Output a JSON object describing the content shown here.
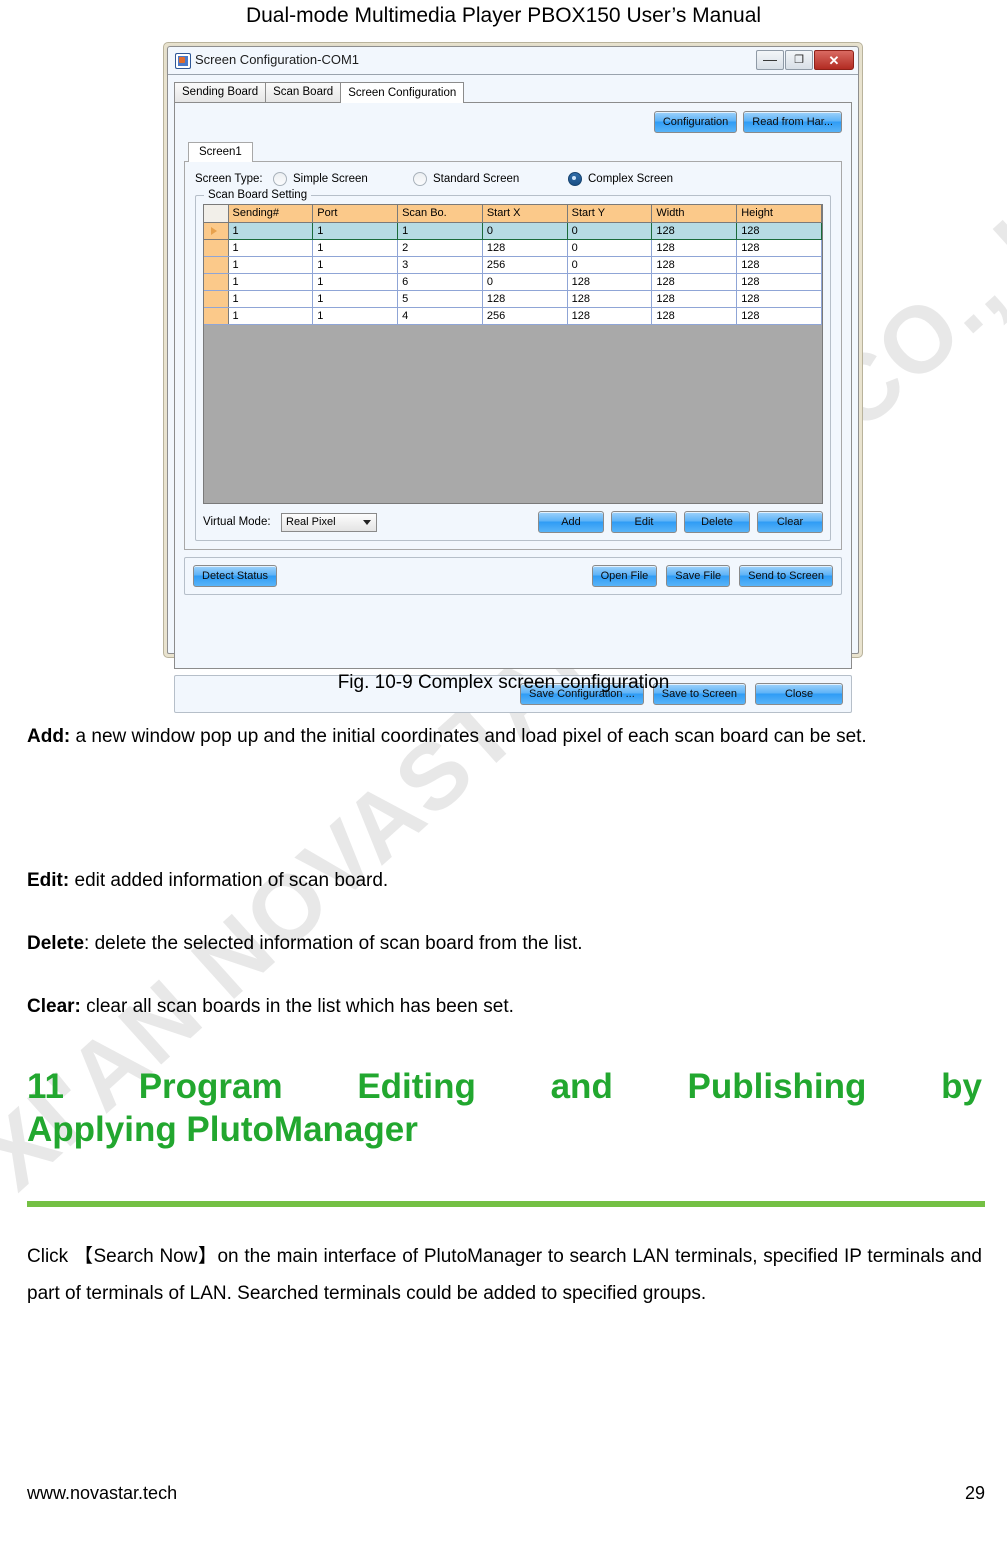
{
  "document": {
    "header": "Dual-mode Multimedia Player PBOX150 User’s Manual",
    "figure_caption": "Fig. 10-9 Complex screen configuration",
    "footer_url": "www.novastar.tech",
    "page_number": "29",
    "watermark": "XI'AN NOVASTAR TECH CO., LTD"
  },
  "paragraphs": {
    "add": {
      "term": "Add:",
      "text": " a new window pop up and the initial coordinates and load pixel of each scan board can be set."
    },
    "edit": {
      "term": "Edit:",
      "text": " edit added information of scan board."
    },
    "delete": {
      "term": "Delete",
      "text": ": delete the selected information of scan board from the list."
    },
    "clear": {
      "term": "Clear:",
      "text": " clear all scan boards in the list which has been set."
    },
    "intro": "Click 【Search Now】on the main interface of PlutoManager to search LAN terminals, specified IP terminals and part of terminals of LAN.  Searched terminals could be added to specified groups."
  },
  "heading": {
    "number": "11",
    "line1_words": [
      "Program",
      "Editing",
      "and",
      "Publishing",
      "by"
    ],
    "line2": "Applying PlutoManager",
    "color": "#22a72f",
    "rule_color": "#74c044"
  },
  "screenshot": {
    "window_title": "Screen Configuration-COM1",
    "window_controls": {
      "minimize": "—",
      "maximize": "❐",
      "close": "✕"
    },
    "tabs": [
      {
        "label": "Sending Board",
        "active": false
      },
      {
        "label": "Scan Board",
        "active": false
      },
      {
        "label": "Screen Configuration",
        "active": true
      }
    ],
    "top_buttons": [
      {
        "label": "Configuration"
      },
      {
        "label": "Read from Har..."
      }
    ],
    "sub_tab": "Screen1",
    "screen_type": {
      "label": "Screen Type:",
      "options": [
        {
          "label": "Simple Screen",
          "checked": false
        },
        {
          "label": "Standard Screen",
          "checked": false
        },
        {
          "label": "Complex Screen",
          "checked": true
        }
      ]
    },
    "scan_board_setting": {
      "title": "Scan Board Setting",
      "columns": [
        "Sending#",
        "Port",
        "Scan Bo.",
        "Start X",
        "Start Y",
        "Width",
        "Height"
      ],
      "rows": [
        {
          "selected": true,
          "cells": [
            "1",
            "1",
            "1",
            "0",
            "0",
            "128",
            "128"
          ]
        },
        {
          "selected": false,
          "cells": [
            "1",
            "1",
            "2",
            "128",
            "0",
            "128",
            "128"
          ]
        },
        {
          "selected": false,
          "cells": [
            "1",
            "1",
            "3",
            "256",
            "0",
            "128",
            "128"
          ]
        },
        {
          "selected": false,
          "cells": [
            "1",
            "1",
            "6",
            "0",
            "128",
            "128",
            "128"
          ]
        },
        {
          "selected": false,
          "cells": [
            "1",
            "1",
            "5",
            "128",
            "128",
            "128",
            "128"
          ]
        },
        {
          "selected": false,
          "cells": [
            "1",
            "1",
            "4",
            "256",
            "128",
            "128",
            "128"
          ]
        }
      ]
    },
    "virtual_mode": {
      "label": "Virtual Mode:",
      "value": "Real Pixel",
      "buttons": [
        {
          "label": "Add"
        },
        {
          "label": "Edit"
        },
        {
          "label": "Delete"
        },
        {
          "label": "Clear"
        }
      ]
    },
    "action_bar": {
      "detect_status": "Detect Status",
      "buttons": [
        {
          "label": "Open File"
        },
        {
          "label": "Save File"
        },
        {
          "label": "Send to Screen"
        }
      ]
    },
    "footer_bar": {
      "buttons": [
        {
          "label": "Save Configuration ..."
        },
        {
          "label": "Save to Screen"
        },
        {
          "label": "Close"
        }
      ]
    }
  }
}
